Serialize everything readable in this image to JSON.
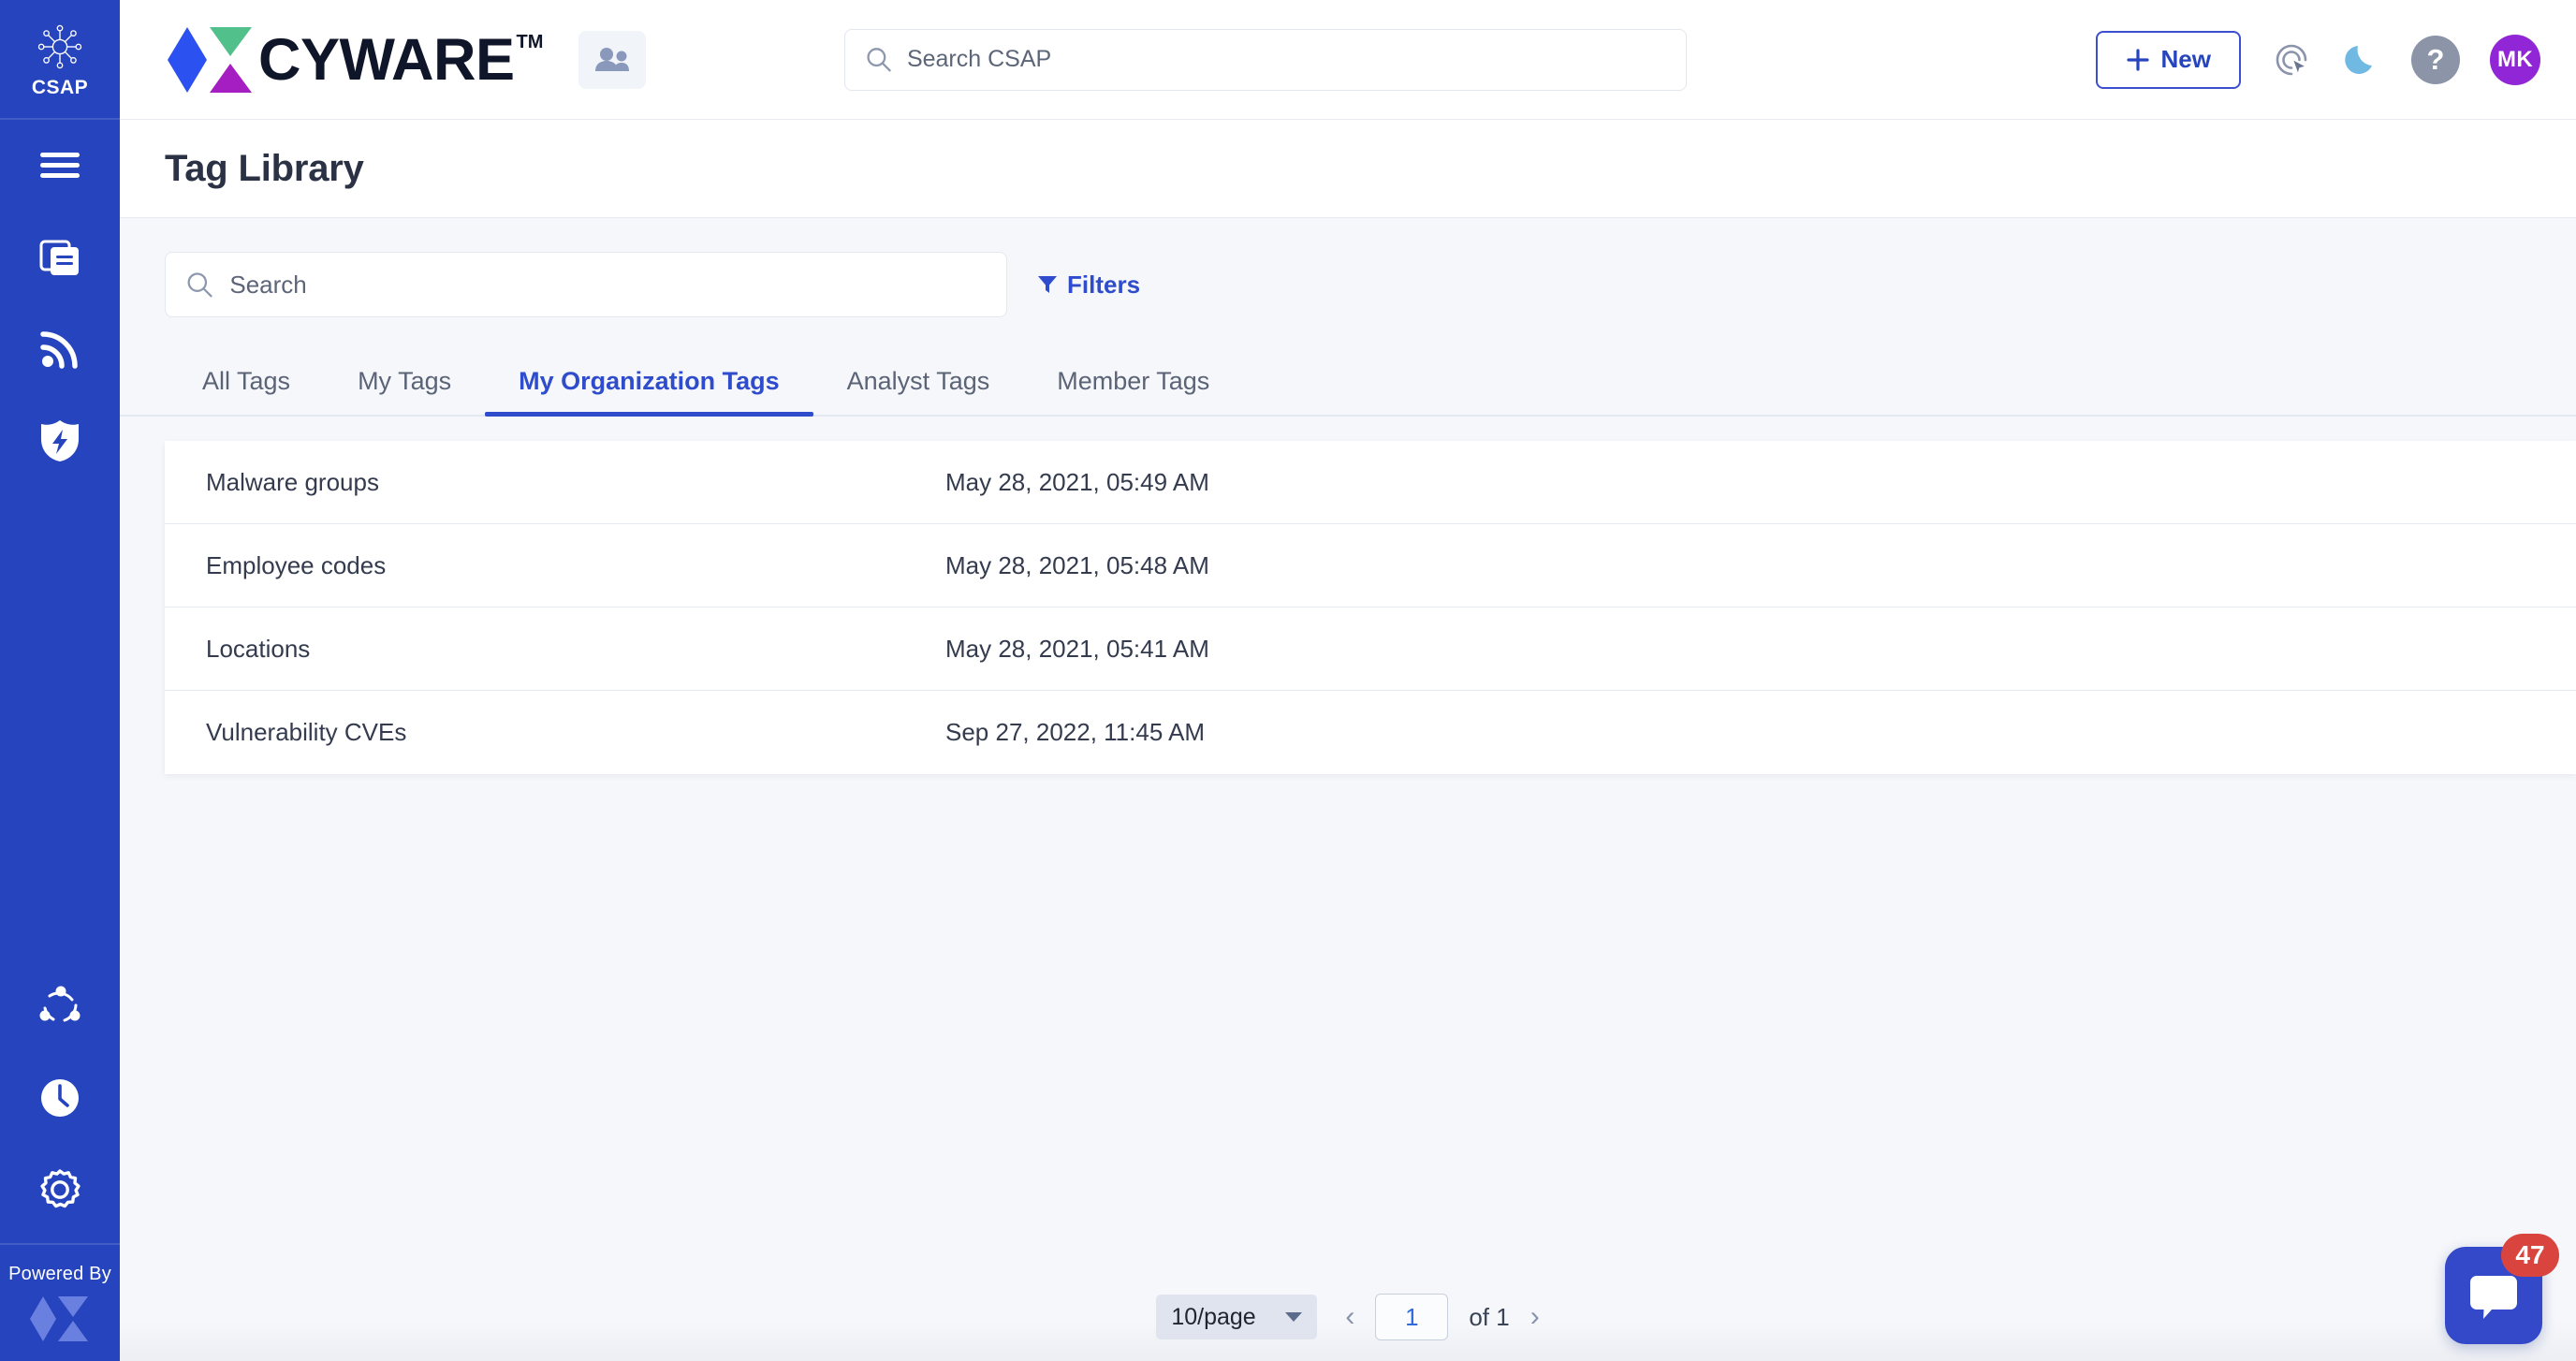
{
  "brand": {
    "sidebar_label": "CSAP",
    "sidebar_icon": "cyware-hub-icon",
    "logo_word": "CYWARE",
    "logo_tm": "TM",
    "powered_by_label": "Powered By",
    "powered_by_icon": "cyware-mark-icon",
    "accent": "#2544bd",
    "link_accent": "#2f4ccc"
  },
  "sidebar": {
    "items": [
      {
        "name": "menu-icon",
        "label": "Menu"
      },
      {
        "name": "documents-icon",
        "label": "Documents"
      },
      {
        "name": "feeds-icon",
        "label": "Feeds"
      },
      {
        "name": "threat-shield-icon",
        "label": "Threat Defender"
      }
    ],
    "bottom_items": [
      {
        "name": "share-network-icon",
        "label": "Collaborate"
      },
      {
        "name": "clock-icon",
        "label": "Recent"
      },
      {
        "name": "gear-icon",
        "label": "Settings"
      }
    ]
  },
  "header": {
    "people_icon": "people-icon",
    "search": {
      "placeholder": "Search CSAP",
      "value": "",
      "icon": "search-icon"
    },
    "new_button": {
      "label": "New",
      "icon": "plus-icon"
    },
    "target_cursor_icon": "target-cursor-icon",
    "dark_mode_icon": "moon-icon",
    "help_icon": "question-mark-icon",
    "help_glyph": "?",
    "avatar": {
      "initials": "MK",
      "color": "#9126d6"
    }
  },
  "page": {
    "title": "Tag Library"
  },
  "toolbar": {
    "search": {
      "placeholder": "Search",
      "value": "",
      "icon": "search-icon"
    },
    "filters": {
      "label": "Filters",
      "icon": "filter-icon"
    }
  },
  "tabs": {
    "active_index": 2,
    "items": [
      {
        "label": "All Tags"
      },
      {
        "label": "My Tags"
      },
      {
        "label": "My Organization Tags"
      },
      {
        "label": "Analyst Tags"
      },
      {
        "label": "Member Tags"
      }
    ]
  },
  "table": {
    "rows": [
      {
        "name": "Malware groups",
        "date": "May 28, 2021, 05:49 AM"
      },
      {
        "name": "Employee codes",
        "date": "May 28, 2021, 05:48 AM"
      },
      {
        "name": "Locations",
        "date": "May 28, 2021, 05:41 AM"
      },
      {
        "name": "Vulnerability CVEs",
        "date": "Sep 27, 2022, 11:45 AM"
      }
    ]
  },
  "pagination": {
    "per_page": "10/page",
    "prev_glyph": "‹",
    "next_glyph": "›",
    "current_page": "1",
    "total_label": "of 1"
  },
  "chat": {
    "badge_count": "47",
    "icon": "chat-bubble-icon"
  }
}
